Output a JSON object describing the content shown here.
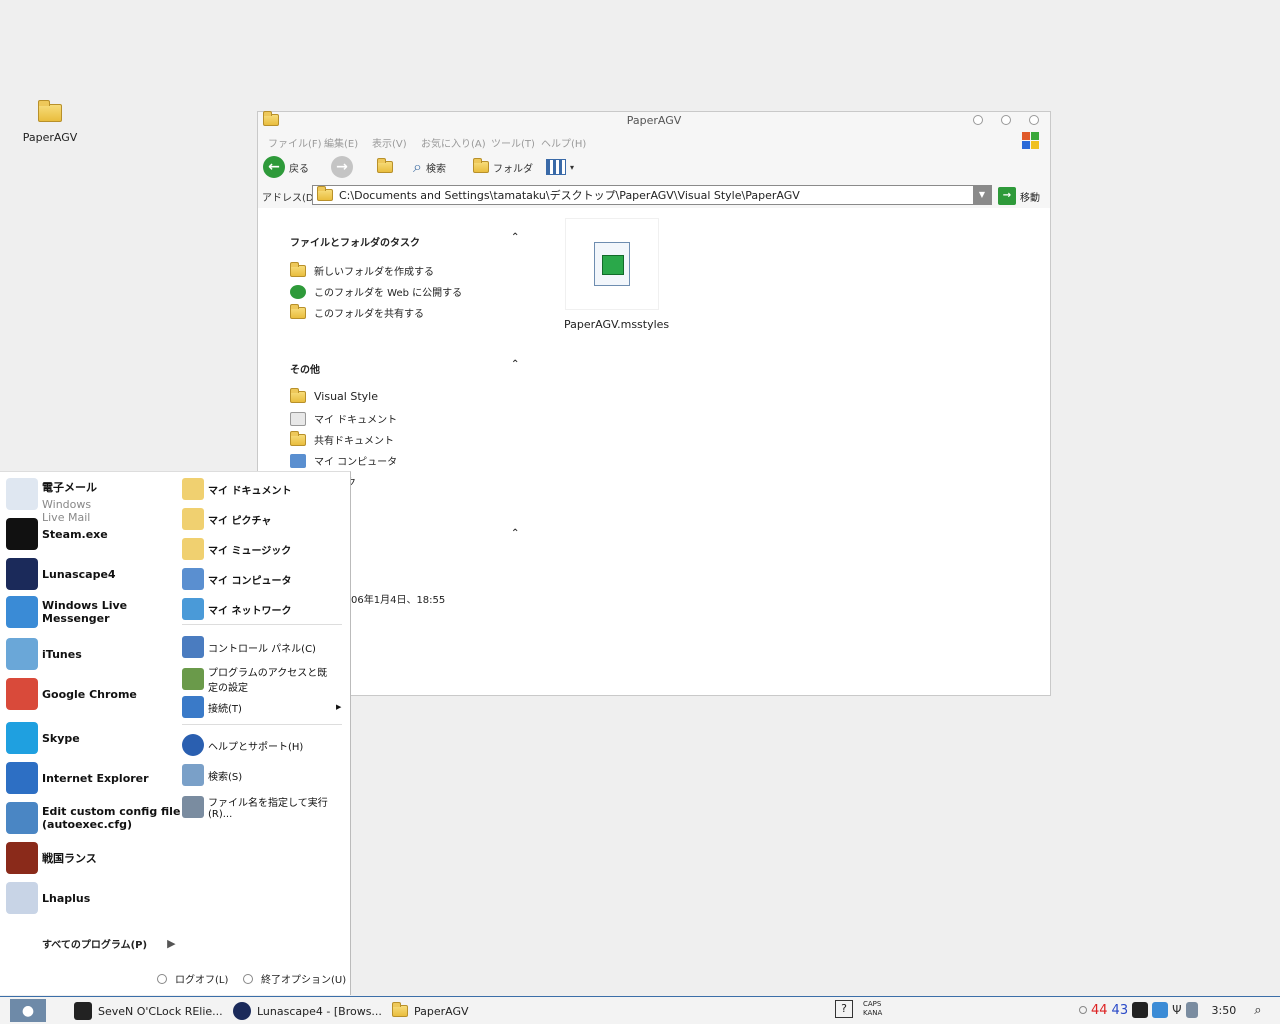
{
  "desktop": {
    "icon_label": "PaperAGV"
  },
  "window": {
    "title": "PaperAGV",
    "menu": [
      "ファイル(F)",
      "編集(E)",
      "表示(V)",
      "お気に入り(A)",
      "ツール(T)",
      "ヘルプ(H)"
    ],
    "toolbar": {
      "back": "戻る",
      "search": "検索",
      "folders": "フォルダ"
    },
    "address": {
      "label": "アドレス(D)",
      "value": "C:\\Documents and Settings\\tamataku\\デスクトップ\\PaperAGV\\Visual Style\\PaperAGV",
      "go": "移動"
    },
    "tasks": {
      "title": "ファイルとフォルダのタスク",
      "items": [
        "新しいフォルダを作成する",
        "このフォルダを Web に公開する",
        "このフォルダを共有する"
      ]
    },
    "other": {
      "title": "その他",
      "items": [
        "Visual Style",
        "マイ ドキュメント",
        "共有ドキュメント",
        "マイ コンピュータ",
        "ワーク"
      ]
    },
    "details": {
      "date": "06年1月4日、18:55"
    },
    "file": {
      "name": "PaperAGV.msstyles"
    }
  },
  "start_menu": {
    "programs": [
      {
        "name": "電子メール",
        "sub": "Windows Live Mail",
        "icon": "mail-icon",
        "color": "#dfe7f1"
      },
      {
        "name": "Steam.exe",
        "sub": "",
        "icon": "steam-icon",
        "color": "#111111"
      },
      {
        "name": "Lunascape4",
        "sub": "",
        "icon": "lunascape-icon",
        "color": "#1b2a5a"
      },
      {
        "name": "Windows Live\nMessenger",
        "sub": "",
        "icon": "messenger-icon",
        "color": "#3a8bd6"
      },
      {
        "name": "iTunes",
        "sub": "",
        "icon": "itunes-icon",
        "color": "#6aa7d8"
      },
      {
        "name": "Google Chrome",
        "sub": "",
        "icon": "chrome-icon",
        "color": "#d94a3a"
      },
      {
        "name": "Skype",
        "sub": "",
        "icon": "skype-icon",
        "color": "#1fa0e0"
      },
      {
        "name": "Internet Explorer",
        "sub": "",
        "icon": "ie-icon",
        "color": "#2d6fc4"
      },
      {
        "name": "Edit custom config file\n(autoexec.cfg)",
        "sub": "",
        "icon": "notepad-icon",
        "color": "#4a86c4"
      },
      {
        "name": "戦国ランス",
        "sub": "",
        "icon": "rance-icon",
        "color": "#8a2a1a"
      },
      {
        "name": "Lhaplus",
        "sub": "",
        "icon": "lhaplus-icon",
        "color": "#c8d4e6"
      }
    ],
    "places": [
      {
        "label": "マイ ドキュメント",
        "bold": true,
        "icon": "my-documents-icon",
        "color": "#f0d070"
      },
      {
        "label": "マイ ピクチャ",
        "bold": true,
        "icon": "my-pictures-icon",
        "color": "#f0d070"
      },
      {
        "label": "マイ ミュージック",
        "bold": true,
        "icon": "my-music-icon",
        "color": "#f0d070"
      },
      {
        "label": "マイ コンピュータ",
        "bold": true,
        "icon": "my-computer-icon",
        "color": "#5a8fd0"
      },
      {
        "label": "マイ ネットワーク",
        "bold": true,
        "icon": "my-network-icon",
        "color": "#4a9ad8"
      }
    ],
    "system": [
      {
        "label": "コントロール パネル(C)",
        "icon": "control-panel-icon",
        "color": "#4a7cc0"
      },
      {
        "label": "プログラムのアクセスと既定の設定",
        "icon": "program-access-icon",
        "color": "#6a9a4a"
      },
      {
        "label": "接続(T)",
        "icon": "connect-icon",
        "color": "#3a7ac8"
      }
    ],
    "help": [
      {
        "label": "ヘルプとサポート(H)",
        "icon": "help-icon",
        "color": "#2a5fb0"
      },
      {
        "label": "検索(S)",
        "icon": "search-icon",
        "color": "#7aa0c8"
      },
      {
        "label": "ファイル名を指定して実行(R)...",
        "icon": "run-icon",
        "color": "#7a8ca0"
      }
    ],
    "all_programs": "すべてのプログラム(P)",
    "logoff": "ログオフ(L)",
    "shutdown": "終了オプション(U)"
  },
  "taskbar": {
    "buttons": [
      {
        "label": "SeveN O'CLock RElie...",
        "icon": "steam-task-icon",
        "color": "#222222"
      },
      {
        "label": "Lunascape4 - [Brows...",
        "icon": "lunascape-task-icon",
        "color": "#1b2a5a"
      },
      {
        "label": "PaperAGV",
        "icon": "folder-task-icon",
        "color": "#e9bd3e"
      }
    ],
    "ime": {
      "caps": "CAPS",
      "kana": "KANA"
    },
    "tray_num1": "44",
    "tray_num2": "43",
    "clock": "3:50"
  }
}
